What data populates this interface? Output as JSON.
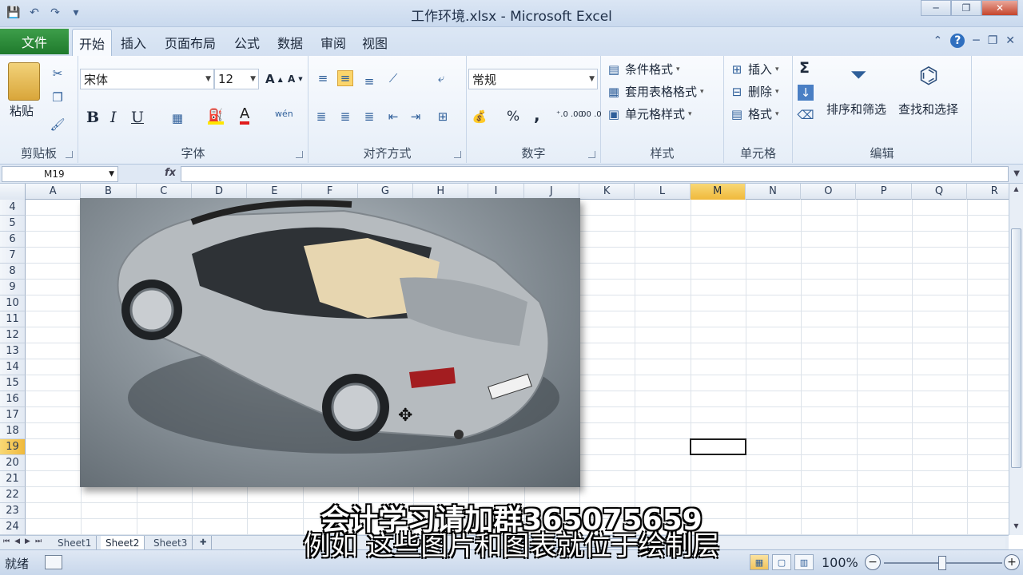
{
  "window": {
    "title": "工作环境.xlsx - Microsoft Excel",
    "controls": {
      "minimize": "─",
      "restore": "❐",
      "close": "✕"
    }
  },
  "qat": {
    "save": "💾",
    "undo": "↶",
    "redo": "↷",
    "customize": "▾"
  },
  "tabs": {
    "file": "文件",
    "items": [
      {
        "label": "开始",
        "active": true
      },
      {
        "label": "插入",
        "active": false
      },
      {
        "label": "页面布局",
        "active": false
      },
      {
        "label": "公式",
        "active": false
      },
      {
        "label": "数据",
        "active": false
      },
      {
        "label": "审阅",
        "active": false
      },
      {
        "label": "视图",
        "active": false
      }
    ]
  },
  "ribbon": {
    "clipboard": {
      "label": "剪贴板",
      "paste": "粘贴"
    },
    "font": {
      "label": "字体",
      "font_name": "宋体",
      "font_size": "12",
      "grow": "A",
      "shrink": "A",
      "bold": "B",
      "italic": "I",
      "underline": "U",
      "font_color_letter": "A",
      "wen": "wén"
    },
    "alignment": {
      "label": "对齐方式"
    },
    "number": {
      "label": "数字",
      "format": "常规",
      "percent": "%",
      "comma": ",",
      "inc_decimal": "+.0 .00",
      "dec_decimal": ".00 →.0"
    },
    "styles": {
      "label": "样式",
      "conditional": "条件格式",
      "table": "套用表格格式",
      "cell": "单元格样式"
    },
    "cells": {
      "label": "单元格",
      "insert": "插入",
      "delete": "删除",
      "format": "格式"
    },
    "editing": {
      "label": "编辑",
      "sigma": "Σ",
      "sort": "排序和筛选",
      "find": "查找和选择"
    }
  },
  "formula_bar": {
    "name_box": "M19",
    "fx": "fx",
    "value": ""
  },
  "grid": {
    "columns": [
      "A",
      "B",
      "C",
      "D",
      "E",
      "F",
      "G",
      "H",
      "I",
      "J",
      "K",
      "L",
      "M",
      "N",
      "O",
      "P",
      "Q",
      "R"
    ],
    "selected_column": "M",
    "rows": [
      "4",
      "5",
      "6",
      "7",
      "8",
      "9",
      "10",
      "11",
      "12",
      "13",
      "14",
      "15",
      "16",
      "17",
      "18",
      "19",
      "20",
      "21",
      "22",
      "23",
      "24"
    ],
    "selected_row": "19",
    "picture_alt": "silver convertible car photo"
  },
  "sheets": [
    {
      "label": "Sheet1",
      "active": false
    },
    {
      "label": "Sheet2",
      "active": true
    },
    {
      "label": "Sheet3",
      "active": false
    }
  ],
  "status": {
    "ready": "就绪",
    "zoom": "100%",
    "zoom_minus": "−",
    "zoom_plus": "+"
  },
  "subtitles": {
    "line1": "会计学习请加群365075659",
    "line2": "例如 这些图片和图表就位于绘制层"
  },
  "colors": {
    "file_tab": "#2a8a38",
    "selection_header": "#f0c350",
    "ribbon_bg": "#eef3fa"
  }
}
